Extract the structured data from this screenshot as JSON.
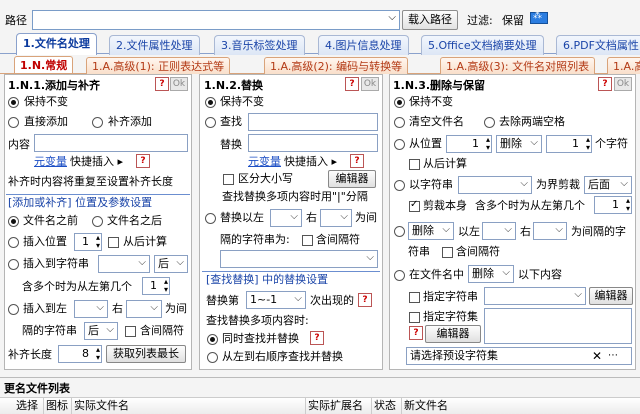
{
  "top": {
    "path_label": "路径",
    "load_path": "载入路径",
    "filter_label": "过滤:",
    "filter_value": "保留"
  },
  "tabs": [
    "1.文件名处理",
    "2.文件属性处理",
    "3.音乐标签处理",
    "4.图片信息处理",
    "5.Office文档摘要处理",
    "6.PDF文档属性"
  ],
  "subtabs": [
    "1.N.常规",
    "1.A.高级(1): 正则表达式等",
    "1.A.高级(2): 编码与转换等",
    "1.A.高级(3): 文件名对照列表",
    "1.A.高"
  ],
  "g1": {
    "title": "1.N.1.添加与补齐",
    "q": "?",
    "ok": "Ok",
    "keep": "保持不变",
    "direct": "直接添加",
    "pad": "补齐添加",
    "content": "内容",
    "var": "元变量",
    "quick": "快捷插入 ▸",
    "repeat": "补齐时内容将重复至设置补齐长度",
    "sub": "[添加或补齐] 位置及参数设置",
    "before": "文件名之前",
    "after": "文件名之后",
    "insert_pos": "插入位置",
    "pos_val": "1",
    "from_back": "从后计算",
    "insert_to": "插入到字符串",
    "back": "后",
    "multi": "含多个时为从左第几个",
    "multi_val": "1",
    "insert_left": "插入到左",
    "right": "右",
    "between": "为间",
    "sep_str": "隔的字符串",
    "sep_val": "后",
    "include_sep": "含间隔符",
    "pad_len": "补齐长度",
    "pad_val": "8",
    "get_max": "获取列表最长"
  },
  "g2": {
    "title": "1.N.2.替换",
    "q": "?",
    "ok": "Ok",
    "keep": "保持不变",
    "find": "查找",
    "replace": "替换",
    "var": "元变量",
    "quick": "快捷插入 ▸",
    "case": "区分大小写",
    "editor": "编辑器",
    "multi_hint": "查找替换多项内容时用\"|\"分隔",
    "rep_left": "替换以左",
    "right": "右",
    "between": "为间",
    "sep_str": "隔的字符串为:",
    "include_sep": "含间隔符",
    "sub": "[查找替换] 中的替换设置",
    "rep_nth": "替换第",
    "nth_val": "1~-1",
    "nth_suffix": "次出现的",
    "multi_when": "查找替换多项内容时:",
    "simul": "同时查找并替换",
    "seq": "从左到右顺序查找并替换"
  },
  "g3": {
    "title": "1.N.3.删除与保留",
    "q": "?",
    "ok": "Ok",
    "keep": "保持不变",
    "clear": "清空文件名",
    "trim": "去除两端空格",
    "from_pos": "从位置",
    "from_val": "1",
    "del": "删除",
    "count_val": "1",
    "chars": "个字符",
    "from_back": "从后计算",
    "by_str": "以字符串",
    "bound": "为界剪裁",
    "after": "后面",
    "cut_self": "剪裁本身",
    "multi": "含多个时为从左第几个",
    "multi_val": "1",
    "del2": "删除",
    "by_left": "以左",
    "right": "右",
    "between": "为间隔的字",
    "str_suffix": "符串",
    "include_sep": "含间隔符",
    "in_name": "在文件名中",
    "del3": "删除",
    "following": "以下内容",
    "spec_str": "指定字符串",
    "editor": "编辑器",
    "spec_set": "指定字符集",
    "q2": "?",
    "preset": "请选择预设字符集"
  },
  "list": {
    "title": "更名文件列表",
    "cols": [
      "选择",
      "图标",
      "实际文件名",
      "实际扩展名",
      "状态",
      "新文件名"
    ]
  }
}
